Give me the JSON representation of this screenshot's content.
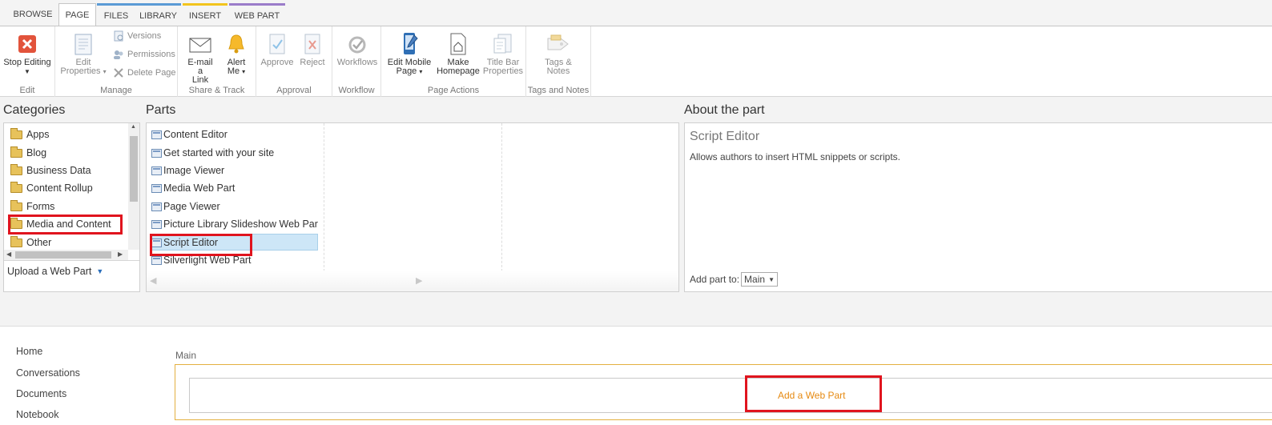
{
  "tabs": {
    "browse": "BROWSE",
    "page": "PAGE",
    "files": "FILES",
    "library": "LIBRARY",
    "insert": "INSERT",
    "webpart": "WEB PART"
  },
  "ribbon": {
    "edit": {
      "stop_editing": "Stop Editing",
      "label": "Edit"
    },
    "manage": {
      "edit_properties_1": "Edit",
      "edit_properties_2": "Properties",
      "versions": "Versions",
      "permissions": "Permissions",
      "delete_page": "Delete Page",
      "label": "Manage"
    },
    "share": {
      "email_1": "E-mail a",
      "email_2": "Link",
      "alert_1": "Alert",
      "alert_2": "Me",
      "label": "Share & Track"
    },
    "approval": {
      "approve": "Approve",
      "reject": "Reject",
      "label": "Approval"
    },
    "workflow": {
      "workflows": "Workflows",
      "label": "Workflow"
    },
    "page_actions": {
      "mobile_1": "Edit Mobile",
      "mobile_2": "Page",
      "homepage_1": "Make",
      "homepage_2": "Homepage",
      "titlebar_1": "Title Bar",
      "titlebar_2": "Properties",
      "label": "Page Actions"
    },
    "tags": {
      "tags_1": "Tags &",
      "tags_2": "Notes",
      "label": "Tags and Notes"
    }
  },
  "adder": {
    "categories_title": "Categories",
    "parts_title": "Parts",
    "about_title": "About the part",
    "categories": [
      "Apps",
      "Blog",
      "Business Data",
      "Content Rollup",
      "Forms",
      "Media and Content",
      "Other"
    ],
    "selected_category": "Media and Content",
    "upload": "Upload a Web Part",
    "parts": [
      "Content Editor",
      "Get started with your site",
      "Image Viewer",
      "Media Web Part",
      "Page Viewer",
      "Picture Library Slideshow Web Par",
      "Script Editor",
      "Silverlight Web Part"
    ],
    "selected_part": "Script Editor",
    "about_name": "Script Editor",
    "about_desc": "Allows authors to insert HTML snippets or scripts.",
    "add_part_to": "Add part to:",
    "zone_option": "Main"
  },
  "nav": [
    "Home",
    "Conversations",
    "Documents",
    "Notebook"
  ],
  "zone": {
    "label": "Main",
    "add_link": "Add a Web Part"
  },
  "colors": {
    "highlight": "#e0141e",
    "orange_link": "#e68a12",
    "selection": "#cde6f7",
    "files_library_tab": "#5b9bd5",
    "insert_tab": "#f2c41d",
    "webpart_tab": "#9b7cc9"
  }
}
